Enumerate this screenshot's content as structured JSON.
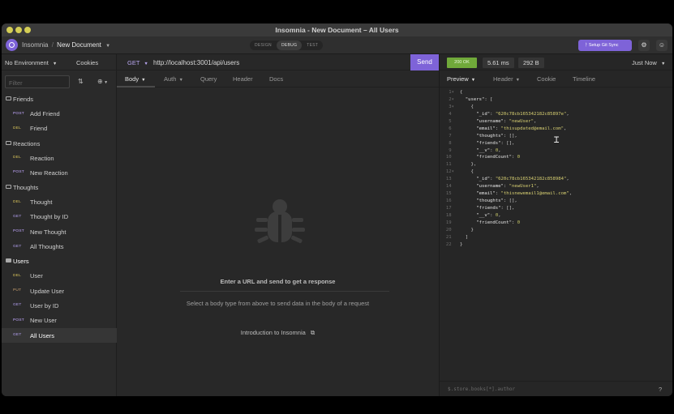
{
  "window": {
    "title": "Insomnia - New Document – All Users"
  },
  "header": {
    "app_name": "Insomnia",
    "separator": "/",
    "document": "New Document",
    "modes": [
      "DESIGN",
      "DEBUG",
      "TEST"
    ],
    "active_mode": "DEBUG",
    "git_sync_label": "Setup Git Sync",
    "settings_icon": "gear-icon",
    "account_icon": "user-icon",
    "accent_color": "#7e63d8"
  },
  "sidebar": {
    "environment": "No Environment",
    "cookies": "Cookies",
    "filter_placeholder": "Filter",
    "groups": [
      {
        "name": "Friends",
        "items": [
          {
            "method": "POST",
            "name": "Add Friend"
          },
          {
            "method": "DEL",
            "name": "Friend"
          }
        ]
      },
      {
        "name": "Reactions",
        "items": [
          {
            "method": "DEL",
            "name": "Reaction"
          },
          {
            "method": "POST",
            "name": "New Reaction"
          }
        ]
      },
      {
        "name": "Thoughts",
        "items": [
          {
            "method": "DEL",
            "name": "Thought"
          },
          {
            "method": "GET",
            "name": "Thought by ID"
          },
          {
            "method": "POST",
            "name": "New Thought"
          },
          {
            "method": "GET",
            "name": "All Thoughts"
          }
        ]
      },
      {
        "name": "Users",
        "items": [
          {
            "method": "DEL",
            "name": "User"
          },
          {
            "method": "PUT",
            "name": "Update User"
          },
          {
            "method": "GET",
            "name": "User by ID"
          },
          {
            "method": "POST",
            "name": "New User"
          },
          {
            "method": "GET",
            "name": "All Users"
          }
        ]
      }
    ]
  },
  "request": {
    "method": "GET",
    "url": "http://localhost:3001/api/users",
    "send_label": "Send",
    "tabs": [
      "Body",
      "Auth",
      "Query",
      "Header",
      "Docs"
    ],
    "empty_title": "Enter a URL and send to get a response",
    "empty_hint": "Select a body type from above to send data in the body of a request",
    "intro_link": "Introduction to Insomnia"
  },
  "response": {
    "status": "200 OK",
    "time": "5.61 ms",
    "size": "292 B",
    "timestamp": "Just Now",
    "tabs": [
      "Preview",
      "Header",
      "Cookie",
      "Timeline"
    ],
    "filter_placeholder": "$.store.books[*].author",
    "status_color": "#70a93a",
    "lines": [
      "{",
      "  \"users\": [",
      "    {",
      "      \"_id\": \"620c78cb165342182c85897e\",",
      "      \"username\": \"newUser\",",
      "      \"email\": \"thisupdated@email.com\",",
      "      \"thoughts\": [],",
      "      \"friends\": [],",
      "      \"__v\": 0,",
      "      \"friendCount\": 0",
      "    },",
      "    {",
      "      \"_id\": \"620c78cb165342182c858984\",",
      "      \"username\": \"newUser1\",",
      "      \"email\": \"thisnewemail1@email.com\",",
      "      \"thoughts\": [],",
      "      \"friends\": [],",
      "      \"__v\": 0,",
      "      \"friendCount\": 0",
      "    }",
      "  ]",
      "}"
    ]
  }
}
